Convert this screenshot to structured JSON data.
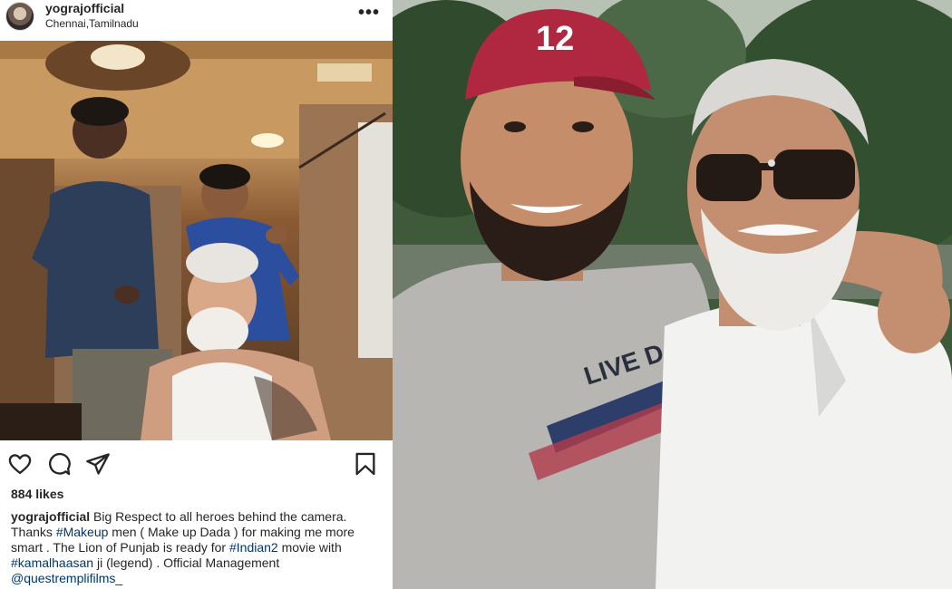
{
  "post": {
    "username": "yograjofficial",
    "location": "Chennai,Tamilnadu",
    "more_icon": "•••",
    "likes": "884 likes",
    "caption": {
      "username": "yograjofficial",
      "t1": " Big Respect to all heroes behind the camera. Thanks ",
      "tag1": "#Makeup",
      "t2": " men ( Make up Dada ) for making me more smart . The Lion of Punjab is ready for ",
      "tag2": "#Indian2",
      "t3": " movie with ",
      "tag3": "#kamalhaasan",
      "t4": " ji (legend) .  Official Management ",
      "mention": "@questremplifilms_"
    },
    "icons": [
      "heart-icon",
      "comment-icon",
      "share-icon",
      "bookmark-icon"
    ]
  },
  "photo": {
    "cap_number": "12",
    "shirt_text": "LIVE DARE"
  },
  "colors": {
    "text": "#262626",
    "link": "#00376b",
    "cap_red": "#b0283f"
  }
}
